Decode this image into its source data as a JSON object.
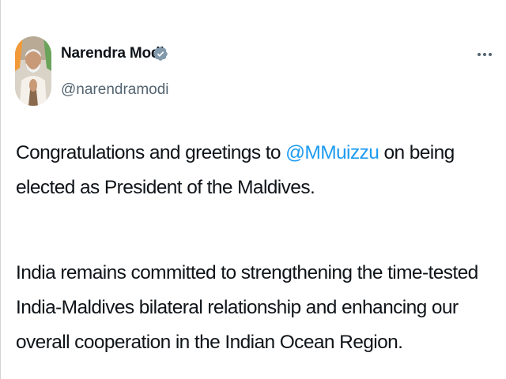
{
  "tweet": {
    "author": {
      "name": "Narendra Modi",
      "handle": "@narendramodi",
      "verified_icon": "verified-badge-icon",
      "avatar_icon": "avatar"
    },
    "menu_icon": "more-options-icon",
    "paragraph_1": {
      "before": "Congratulations and greetings to ",
      "mention": "@MMuizzu",
      "after": " on being elected as President of the Maldives."
    },
    "paragraph_2": "India remains committed to strengthening the time-tested India-Maldives bilateral relationship and enhancing our overall cooperation in the Indian Ocean Region."
  },
  "colors": {
    "text": "#0f1419",
    "secondary_text": "#536471",
    "link": "#1d9bf0",
    "verified_badge": "#829aab"
  }
}
